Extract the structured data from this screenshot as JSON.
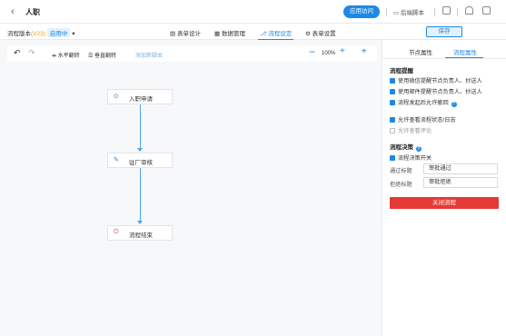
{
  "header": {
    "back_icon": "chevron-left-icon",
    "app_title": "人职",
    "app_button": "应用访问",
    "script_label": "后端脚本",
    "icons": [
      "monitor-icon",
      "bell-icon",
      "grid-icon"
    ]
  },
  "subheader": {
    "version_label": "流程版本",
    "version_number": "(V23)",
    "version_status": "启用中",
    "tabs": [
      {
        "label": "表单设计",
        "icon": "form-icon"
      },
      {
        "label": "数据管理",
        "icon": "database-icon"
      },
      {
        "label": "流程设定",
        "icon": "flow-icon"
      },
      {
        "label": "表单设置",
        "icon": "settings-icon"
      }
    ],
    "active_tab": "流程设定",
    "save_label": "保存"
  },
  "toolbar": {
    "horizontal_label": "水平翻转",
    "vertical_label": "垂直翻转",
    "script_link": "添加新脚本",
    "zoom_level": "100%"
  },
  "flow": {
    "nodes": [
      {
        "label": "入职申请",
        "icon": "start-icon"
      },
      {
        "label": "驻厂审核",
        "icon": "approve-icon"
      },
      {
        "label": "流程结束",
        "icon": "end-icon"
      }
    ]
  },
  "panel": {
    "tabs": [
      "节点属性",
      "流程属性"
    ],
    "active_tab": "流程属性",
    "reminder_title": "流程提醒",
    "reminders": [
      {
        "label": "使用微信提醒节点负责人、抄送人",
        "checked": true
      },
      {
        "label": "使用邮件提醒节点负责人、抄送人",
        "checked": true
      },
      {
        "label": "流程发起后允许撤回",
        "checked": true
      },
      {
        "label": "允许查看流程状态/日志",
        "checked": true
      },
      {
        "label": "允许查看评论",
        "checked": false
      }
    ],
    "decision_title": "流程决策",
    "decision_switch": "流程决策开关",
    "approve_label": "通过标题",
    "approve_value": "审批通过",
    "reject_label": "拒绝标题",
    "reject_value": "审批拒绝",
    "close_button": "关闭流程",
    "accent_color": "#1e88e5",
    "danger_color": "#e53935"
  }
}
